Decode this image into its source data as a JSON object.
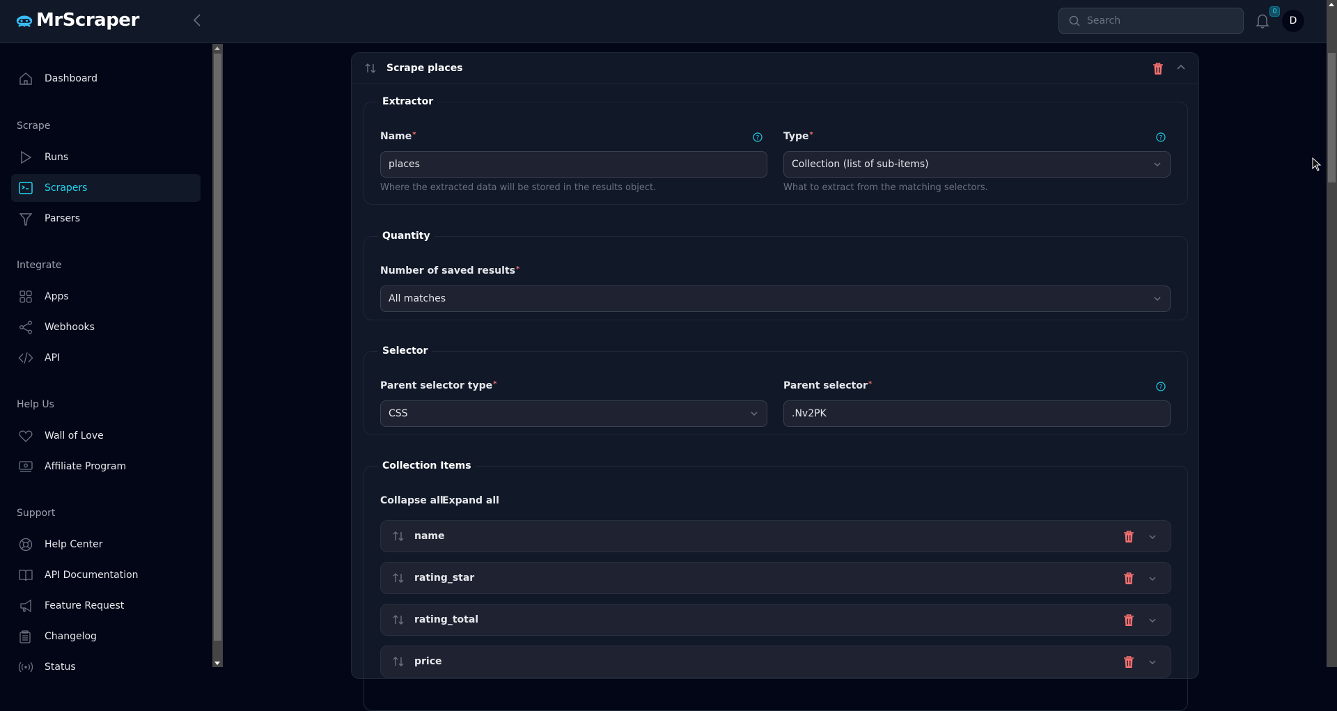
{
  "app": {
    "name": "MrScraper"
  },
  "header": {
    "search_placeholder": "Search",
    "notification_count": "0",
    "avatar_initial": "D"
  },
  "sidebar": {
    "dashboard": "Dashboard",
    "sections": {
      "scrape": "Scrape",
      "integrate": "Integrate",
      "help_us": "Help Us",
      "support": "Support"
    },
    "items": {
      "runs": "Runs",
      "scrapers": "Scrapers",
      "parsers": "Parsers",
      "apps": "Apps",
      "webhooks": "Webhooks",
      "api": "API",
      "wall_of_love": "Wall of Love",
      "affiliate_program": "Affiliate Program",
      "help_center": "Help Center",
      "api_documentation": "API Documentation",
      "feature_request": "Feature Request",
      "changelog": "Changelog",
      "status": "Status"
    },
    "active": "Scrapers"
  },
  "extractor_card": {
    "title": "Scrape places",
    "extractor": {
      "legend": "Extractor",
      "name_label": "Name",
      "name_value": "places",
      "name_hint": "Where the extracted data will be stored in the results object.",
      "type_label": "Type",
      "type_value": "Collection (list of sub-items)",
      "type_hint": "What to extract from the matching selectors."
    },
    "quantity": {
      "legend": "Quantity",
      "label": "Number of saved results",
      "value": "All matches"
    },
    "selector": {
      "legend": "Selector",
      "type_label": "Parent selector type",
      "type_value": "CSS",
      "selector_label": "Parent selector",
      "selector_value": ".Nv2PK"
    },
    "collection": {
      "legend": "Collection Items",
      "collapse_all": "Collapse all",
      "expand_all": "Expand all",
      "items": [
        "name",
        "rating_star",
        "rating_total",
        "price"
      ]
    }
  },
  "colors": {
    "accent": "#22d3ee",
    "danger": "#f87171",
    "background": "#030617",
    "panel": "#111827"
  }
}
